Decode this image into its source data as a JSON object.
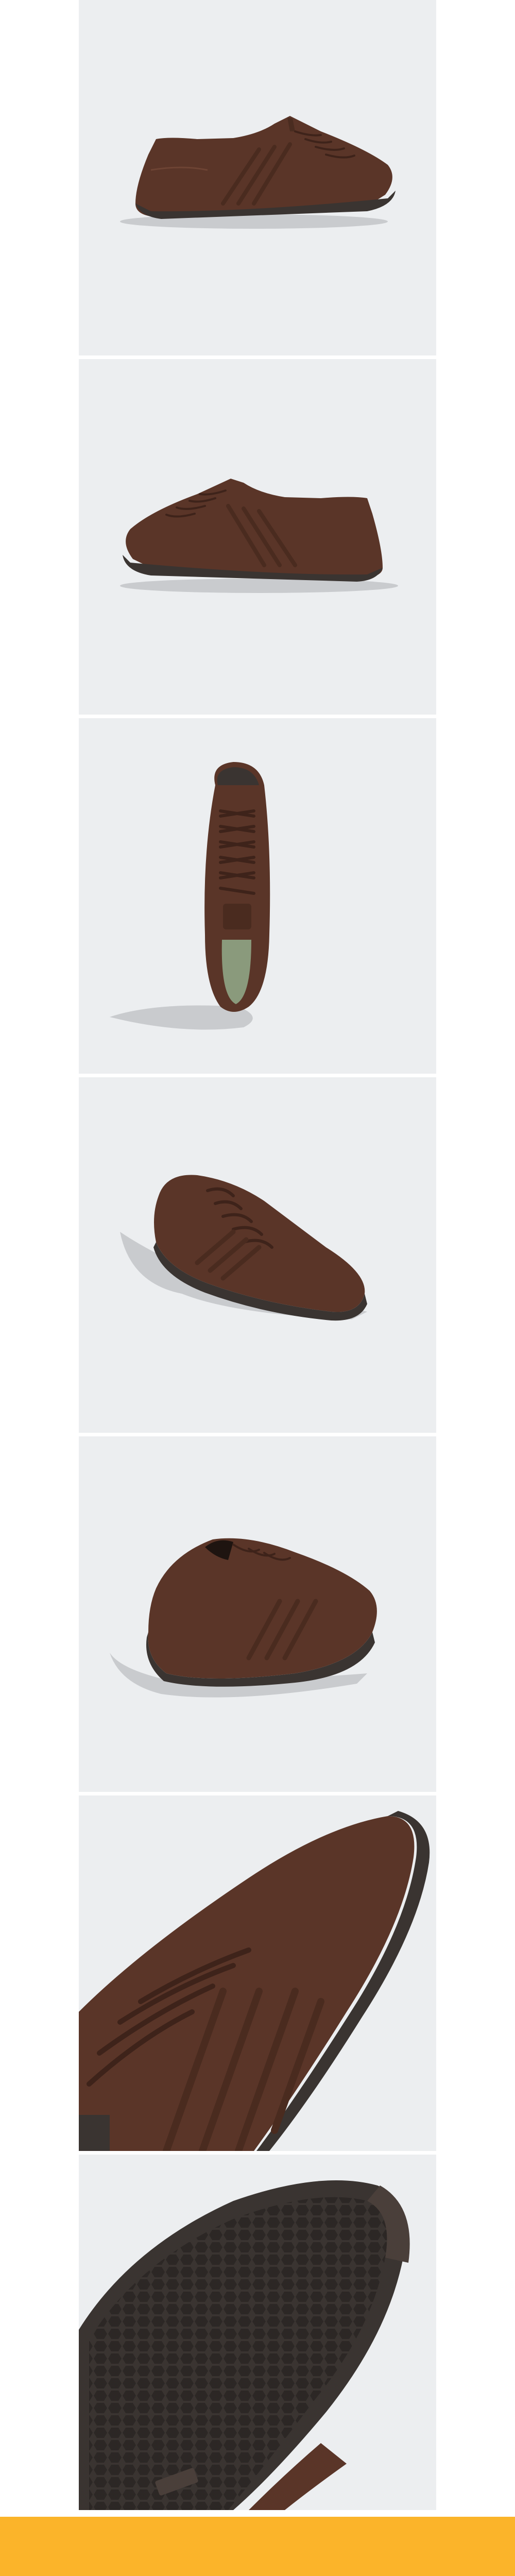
{
  "product": {
    "colors": {
      "upper": "#5a3528",
      "upper_dark": "#3e231a",
      "upper_light": "#6e4434",
      "sole": "#3a3431",
      "sole_edge": "#2c2725",
      "shadow": "#c9cbce",
      "panel_bg": "#eceef0",
      "accent_bar": "#fbb42a",
      "insole": "#8a9a7c"
    }
  },
  "gallery": {
    "images": [
      {
        "view": "side-outer",
        "icon": "shoe-side-icon"
      },
      {
        "view": "side-inner",
        "icon": "shoe-side-icon"
      },
      {
        "view": "top-down",
        "icon": "shoe-top-icon"
      },
      {
        "view": "front-three-quarter",
        "icon": "shoe-front-icon"
      },
      {
        "view": "back-three-quarter",
        "icon": "shoe-back-icon"
      },
      {
        "view": "detail-stripes",
        "icon": "shoe-detail-icon"
      },
      {
        "view": "detail-outsole",
        "icon": "shoe-sole-icon"
      }
    ]
  }
}
